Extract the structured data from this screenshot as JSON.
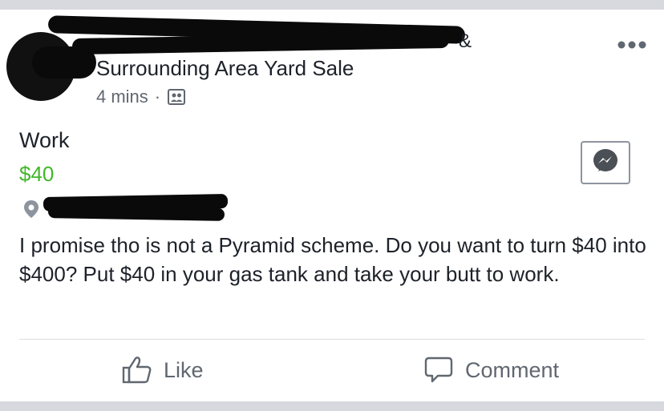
{
  "post": {
    "group_name_suffix": "&",
    "group_name": "Surrounding Area Yard Sale",
    "timestamp": "4 mins",
    "separator": "·",
    "audience_icon": "group-icon",
    "more_icon": "more-horizontal-icon"
  },
  "listing": {
    "title": "Work",
    "price": "$40",
    "price_color": "#42b72a",
    "location_icon": "location-pin-icon",
    "messenger_icon": "messenger-icon",
    "description": "I promise tho is not a Pyramid scheme. Do you want to turn $40 into $400? Put $40 in your gas tank and take your butt to work."
  },
  "actions": {
    "like_label": "Like",
    "like_icon": "thumbs-up-icon",
    "comment_label": "Comment",
    "comment_icon": "comment-bubble-icon"
  }
}
